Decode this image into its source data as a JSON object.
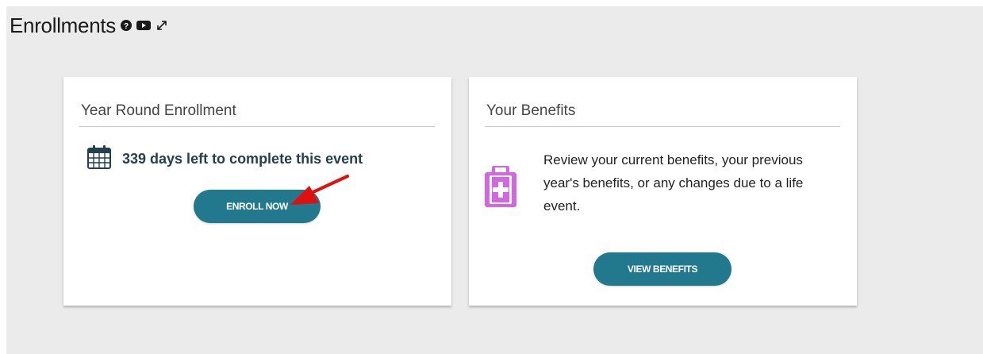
{
  "header": {
    "title": "Enrollments"
  },
  "enrollment_card": {
    "title": "Year Round Enrollment",
    "days_text": "339 days left to complete this event",
    "button_label": "ENROLL NOW"
  },
  "benefits_card": {
    "title": "Your Benefits",
    "description": "Review your current benefits, your previous year's benefits, or any changes due to a life event.",
    "button_label": "VIEW BENEFITS"
  },
  "icons": {
    "help": "question-circle-icon",
    "video": "video-icon",
    "expand": "expand-icon",
    "calendar": "calendar-icon",
    "briefcase": "medical-briefcase-icon"
  },
  "colors": {
    "button": "#22798e",
    "briefcase": "#d466e6",
    "arrow": "#e01010",
    "panel_bg": "#ebebeb"
  }
}
